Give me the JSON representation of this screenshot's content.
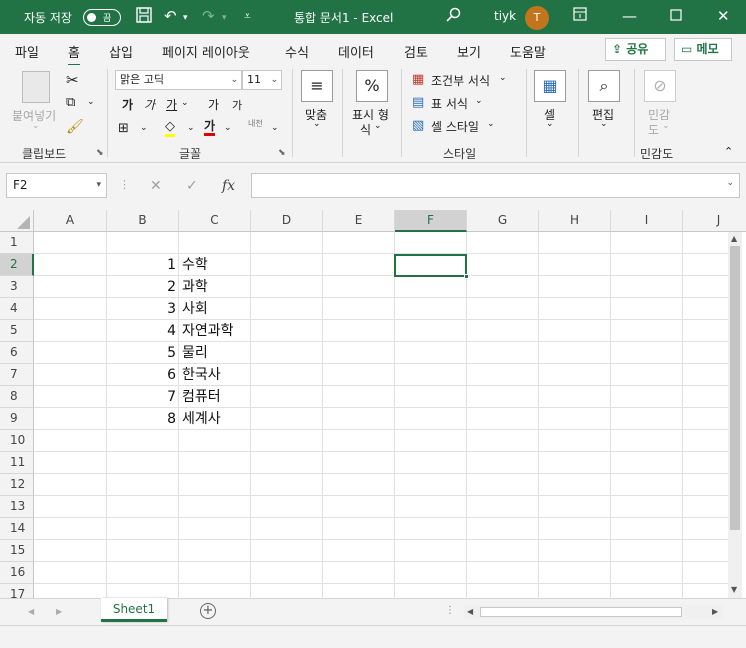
{
  "titlebar": {
    "autosave_label": "자동 저장",
    "autosave_state": "끔",
    "doc_title": "통합 문서1  -  Excel",
    "user_name": "tiyk",
    "user_initial": "T",
    "accent_color": "#217346"
  },
  "tabs": {
    "items": [
      "파일",
      "홈",
      "삽입",
      "페이지 레이아웃",
      "수식",
      "데이터",
      "검토",
      "보기",
      "도움말"
    ],
    "active": "홈",
    "share_label": "공유",
    "memo_label": "메모"
  },
  "ribbon": {
    "clipboard": {
      "paste": "붙여넣기",
      "label": "클립보드"
    },
    "font": {
      "font_name": "맑은 고딕",
      "font_size": "11",
      "bold": "가",
      "italic": "가",
      "underline": "가",
      "grow": "가",
      "shrink": "가",
      "font_color": "가",
      "phonetic": "내천",
      "label": "글꼴"
    },
    "alignment": {
      "label": "맞춤"
    },
    "number": {
      "line1": "표시 형",
      "line2": "식",
      "symbol": "%"
    },
    "styles": {
      "conditional": "조건부 서식",
      "table": "표 서식",
      "cell_style": "셀 스타일",
      "label": "스타일"
    },
    "cells": {
      "label": "셀"
    },
    "editing": {
      "label": "편집"
    },
    "sensitivity": {
      "line1": "민감",
      "line2": "도",
      "label": "민감도"
    }
  },
  "formula_bar": {
    "name_box": "F2",
    "cancel": "✕",
    "enter": "✓",
    "fx": "fx",
    "content": ""
  },
  "grid": {
    "columns": [
      "A",
      "B",
      "C",
      "D",
      "E",
      "F",
      "G",
      "H",
      "I",
      "J"
    ],
    "selected_column": "F",
    "rows": [
      "1",
      "2",
      "3",
      "4",
      "5",
      "6",
      "7",
      "8",
      "9",
      "10",
      "11",
      "12",
      "13",
      "14",
      "15",
      "16",
      "17"
    ],
    "selected_row": "2",
    "data": [
      {
        "row": "2",
        "b": "1",
        "c": "수학"
      },
      {
        "row": "3",
        "b": "2",
        "c": "과학"
      },
      {
        "row": "4",
        "b": "3",
        "c": "사회"
      },
      {
        "row": "5",
        "b": "4",
        "c": "자연과학"
      },
      {
        "row": "6",
        "b": "5",
        "c": "물리"
      },
      {
        "row": "7",
        "b": "6",
        "c": "한국사"
      },
      {
        "row": "8",
        "b": "7",
        "c": "컴퓨터"
      },
      {
        "row": "9",
        "b": "8",
        "c": "세계사"
      }
    ]
  },
  "sheets": {
    "active": "Sheet1",
    "add": "+"
  }
}
